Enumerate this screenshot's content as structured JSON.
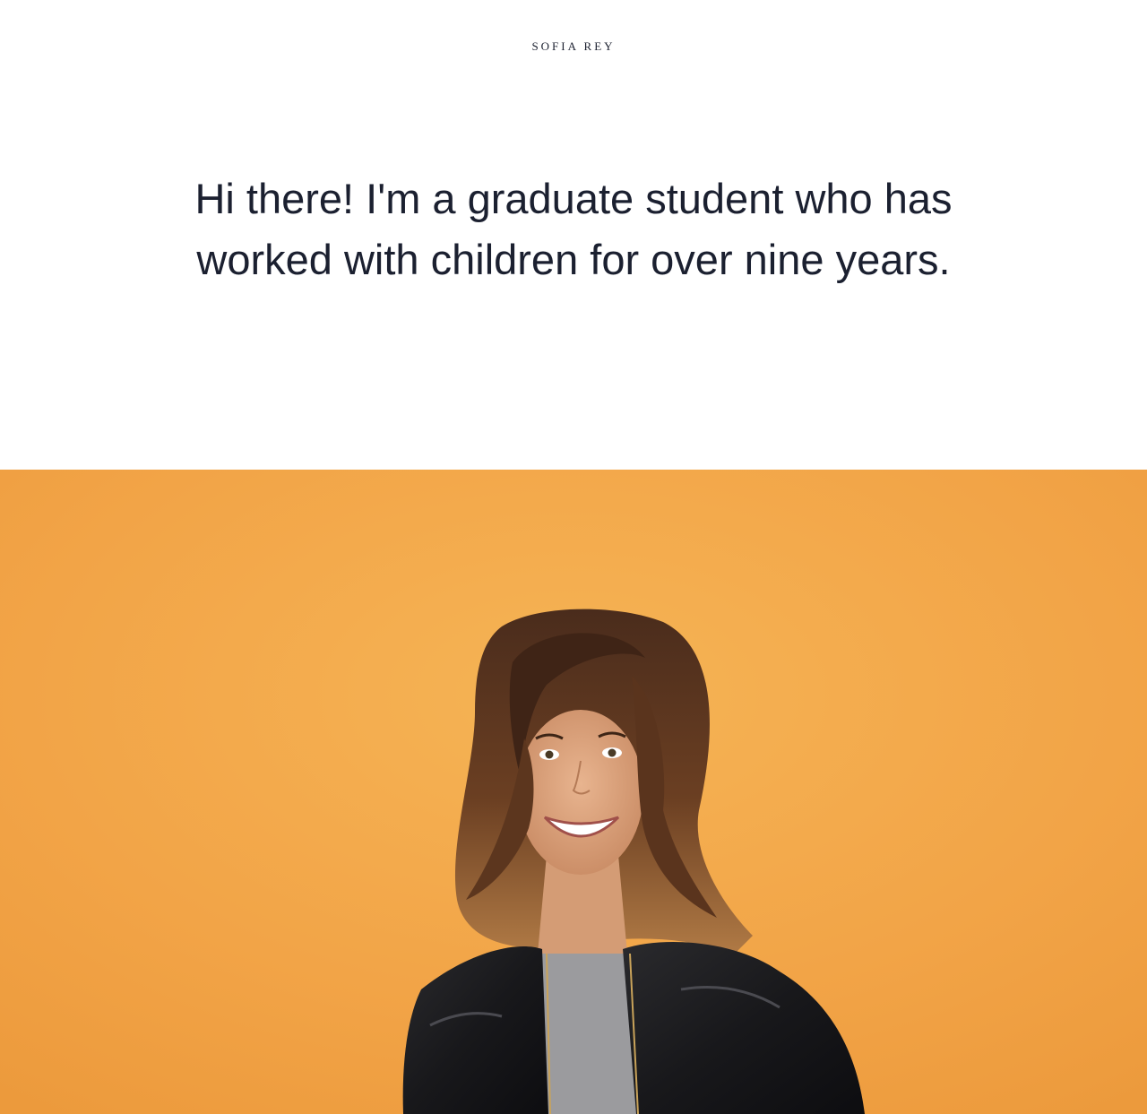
{
  "header": {
    "brand": "SOFIA REY"
  },
  "intro": {
    "text": "Hi there! I'm a graduate student who has worked with children for over nine years."
  },
  "hero": {
    "image": "portrait-photo",
    "background_color": "#F2A64A"
  }
}
